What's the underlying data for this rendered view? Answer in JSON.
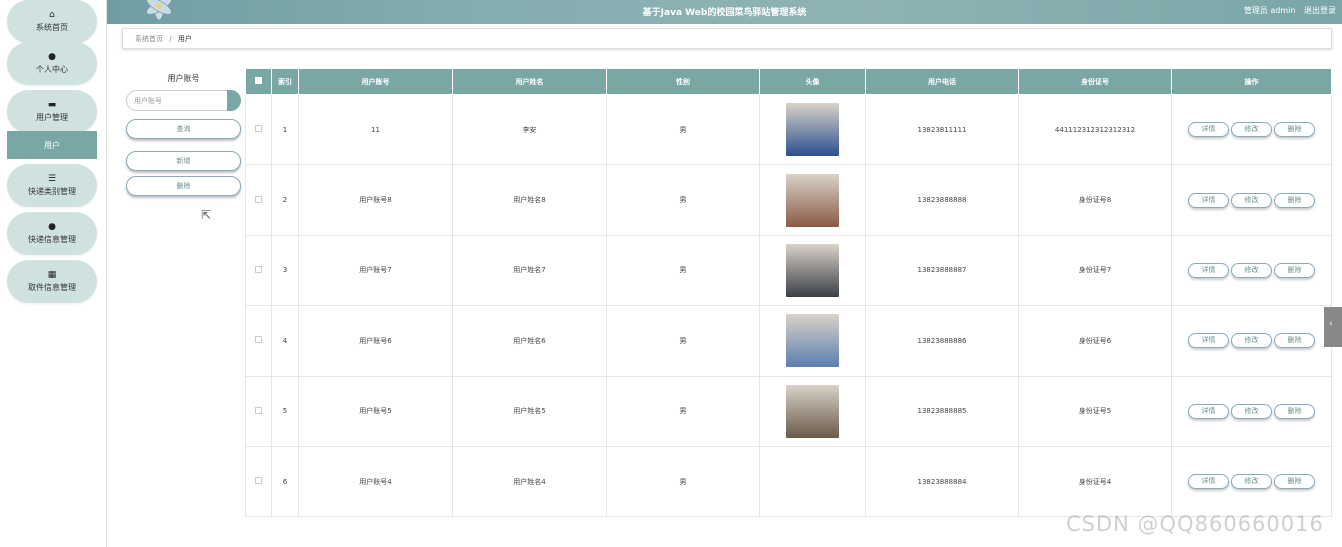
{
  "header": {
    "title": "基于Java Web的校园菜鸟驿站管理系统",
    "role": "管理员 admin",
    "logout": "退出登录"
  },
  "sidebar": {
    "items": [
      {
        "label": "系统首页",
        "icon": "home-icon",
        "glyph": "⌂"
      },
      {
        "label": "个人中心",
        "icon": "user-icon",
        "glyph": "●"
      },
      {
        "label": "用户管理",
        "icon": "briefcase-icon",
        "glyph": "▬"
      },
      {
        "label": "快递类别管理",
        "icon": "sliders-icon",
        "glyph": "☰"
      },
      {
        "label": "快递信息管理",
        "icon": "location-icon",
        "glyph": "●"
      },
      {
        "label": "取件信息管理",
        "icon": "grid-icon",
        "glyph": "▦"
      }
    ],
    "active_sub": "用户"
  },
  "breadcrumb": {
    "home": "系统首页",
    "sep": "/",
    "current": "用户"
  },
  "filter": {
    "label": "用户账号",
    "placeholder": "用户账号",
    "query": "查询",
    "add": "新增",
    "delete": "删除"
  },
  "table": {
    "headers": [
      "索引",
      "用户账号",
      "用户姓名",
      "性别",
      "头像",
      "用户电话",
      "身份证号",
      "操作"
    ],
    "rows": [
      {
        "index": "1",
        "account": "11",
        "name": "李安",
        "gender": "男",
        "phone": "13823811111",
        "idcard": "441112312312312312",
        "avatar": "#2c4f8f"
      },
      {
        "index": "2",
        "account": "用户账号8",
        "name": "用户姓名8",
        "gender": "男",
        "phone": "13823888888",
        "idcard": "身份证号8",
        "avatar": "#8a5a46"
      },
      {
        "index": "3",
        "account": "用户账号7",
        "name": "用户姓名7",
        "gender": "男",
        "phone": "13823888887",
        "idcard": "身份证号7",
        "avatar": "#3a3f47"
      },
      {
        "index": "4",
        "account": "用户账号6",
        "name": "用户姓名6",
        "gender": "男",
        "phone": "13823888886",
        "idcard": "身份证号6",
        "avatar": "#5b7fb0"
      },
      {
        "index": "5",
        "account": "用户账号5",
        "name": "用户姓名5",
        "gender": "男",
        "phone": "13823888885",
        "idcard": "身份证号5",
        "avatar": "#6a5a4a"
      },
      {
        "index": "6",
        "account": "用户账号4",
        "name": "用户姓名4",
        "gender": "男",
        "phone": "13823888884",
        "idcard": "身份证号4",
        "avatar": ""
      }
    ],
    "ops": {
      "detail": "详情",
      "edit": "修改",
      "delete": "删除"
    }
  },
  "watermark": "CSDN @QQ860660016"
}
